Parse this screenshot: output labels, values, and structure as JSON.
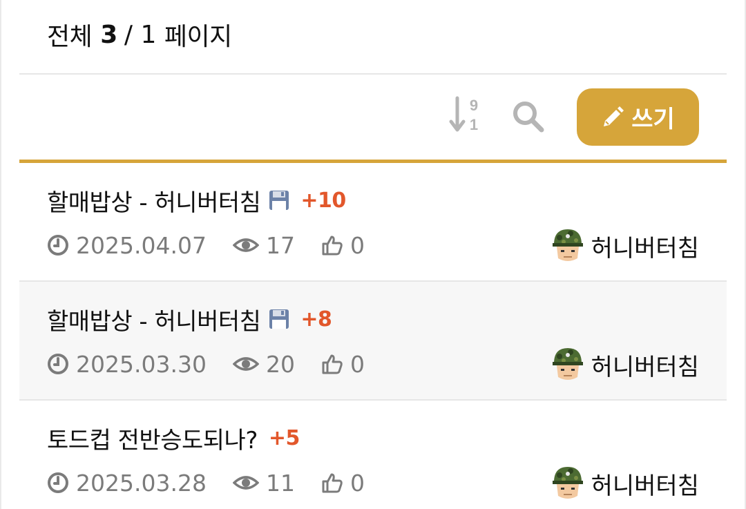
{
  "header": {
    "total_label": "전체",
    "total_count": "3",
    "separator": "/",
    "page_count": "1",
    "page_label": "페이지"
  },
  "toolbar": {
    "sort_icon": "sort-numeric-desc-icon",
    "sort_top_digit": "9",
    "sort_bottom_digit": "1",
    "search_icon": "search-icon",
    "write_label": "쓰기",
    "write_icon": "pencil-icon"
  },
  "colors": {
    "accent": "#d6a53a",
    "comment_count": "#e2572b",
    "meta_text": "#7b7b7b",
    "icon_gray": "#b5b5b5"
  },
  "posts": [
    {
      "title": "할매밥상 - 허니버터침",
      "has_attachment": true,
      "comment_count": "+10",
      "date": "2025.04.07",
      "views": "17",
      "likes": "0",
      "author": "허니버터침"
    },
    {
      "title": "할매밥상 - 허니버터침",
      "has_attachment": true,
      "comment_count": "+8",
      "date": "2025.03.30",
      "views": "20",
      "likes": "0",
      "author": "허니버터침"
    },
    {
      "title": "토드컵 전반승도되나?",
      "has_attachment": false,
      "comment_count": "+5",
      "date": "2025.03.28",
      "views": "11",
      "likes": "0",
      "author": "허니버터침"
    }
  ]
}
